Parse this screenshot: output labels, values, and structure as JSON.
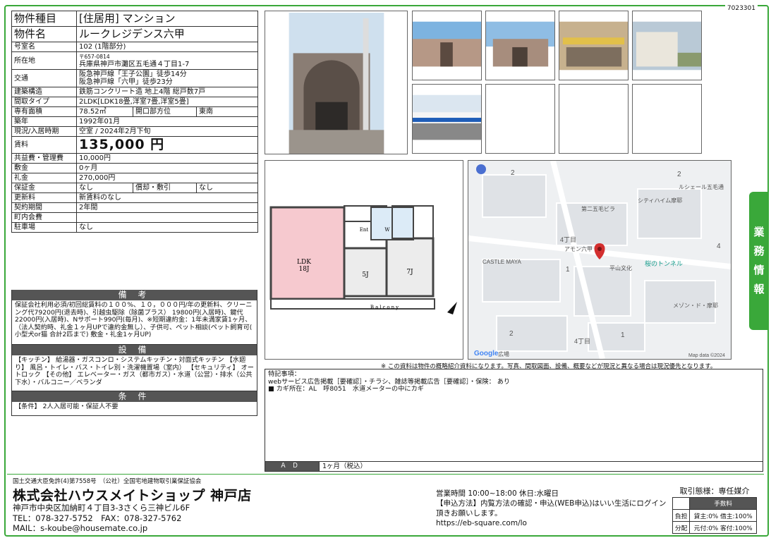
{
  "doc_id": "7023301",
  "spec": [
    {
      "k": "物件種目",
      "v": "[住居用] マンション",
      "big": true
    },
    {
      "k": "物件名",
      "v": "ルークレジデンス六甲",
      "big": true
    },
    {
      "k": "号室名",
      "v": "102 (1階部分)"
    },
    {
      "k": "所在地",
      "v": "〒657-0814",
      "v2": "兵庫県神戸市灘区五毛通４丁目1-7"
    },
    {
      "k": "交通",
      "v": "阪急神戸線「王子公園」徒歩14分",
      "v2": "阪急神戸線「六甲」徒歩23分"
    },
    {
      "k": "建築構造",
      "v": "鉄筋コンクリート造 地上4階 総戸数7戸"
    },
    {
      "k": "間取タイプ",
      "v": "2LDK[LDK18畳,洋室7畳,洋室5畳]"
    },
    {
      "k": "専有面積",
      "v": "78.52㎡",
      "k2": "開口部方位",
      "v3": "東南"
    },
    {
      "k": "築年",
      "v": "1992年01月"
    },
    {
      "k": "現況/入居時期",
      "v": "空室 / 2024年2月下旬"
    },
    {
      "k": "賃料",
      "v": "135,000 円",
      "rent": true
    },
    {
      "k": "共益費・管理費",
      "v": "10,000円"
    },
    {
      "k": "敷金",
      "v": "0ヶ月"
    },
    {
      "k": "礼金",
      "v": "270,000円"
    },
    {
      "k": "保証金",
      "v": "なし",
      "k2": "償却・敷引",
      "v3": "なし"
    },
    {
      "k": "更新料",
      "v": "新賃料のなし"
    },
    {
      "k": "契約期間",
      "v": "2年間"
    },
    {
      "k": "町内会費",
      "v": ""
    },
    {
      "k": "駐車場",
      "v": "なし"
    }
  ],
  "biko": {
    "title": "備 考",
    "text": "保証会社利用必須/初回総賃料の１００%、１０，０００円/年の更新料、クリーニング代79200円(退去時)、引越虫駆除（除菌プラス） 19800円(入居時)、鍵代22000円(入居時)、Nサポート990円(毎月)、※短期違約金：1年未満家賃1ヶ月、（法人契約時、礼金１ヶ月UPで違約金無し）、子供可、ペット相談(ペット飼育可( 小型犬or猫 合計2匹まで) 敷金・礼金1ヶ月UP)"
  },
  "setsubi": {
    "title": "設 備",
    "text": "【キッチン】 給湯器・ガスコンロ・システムキッチン・対面式キッチン 【水廻り】 風呂・トイレ・バス・トイレ別・洗濯機置場（室内） 【セキュリティ】 オートロック 【その他】 エレベーター・ガス（都市ガス）・水道（公営）・排水（公共下水）・バルコニー／ベランダ"
  },
  "joken": {
    "title": "条 件",
    "text": "【条件】 2人入居可能・保証人不要"
  },
  "floorplan": {
    "ldk": "LDK",
    "ldk_size": "18J",
    "r1": "5J",
    "r2": "7J",
    "ent": "Ent",
    "wc": "W",
    "balcony": "Balcony"
  },
  "map": {
    "labels": [
      "ルシェール五毛通",
      "第二五毛ビラ",
      "シティハイム摩耶",
      "4丁目",
      "アモン六甲",
      "CASTLE MAYA",
      "平山文化",
      "桜のトンネル",
      "メゾン・ド・摩耶",
      "4丁目",
      "広場"
    ],
    "numbers": [
      "2",
      "2",
      "4",
      "1",
      "2",
      "1"
    ],
    "logo": "Google",
    "credit": "Map data ©2024"
  },
  "note": "※ この資料は物件の概略紹介資料になります。写真、間取図面、設備、概要などが現況と異なる場合は現況優先となります。",
  "tokki": {
    "title": "特記事項：",
    "l1": "webサービス広告掲載［要確認］・チラシ、雑誌等掲載広告［要確認］・保険： あり",
    "l2": "■ カギ所在：AL　呼8051　水道メーターの中にカギ"
  },
  "ad": {
    "label": "ＡＤ",
    "value": "1ヶ月（税込）"
  },
  "side_tab": [
    "業",
    "務",
    "情",
    "報"
  ],
  "footer": {
    "license": "国土交通大臣免許(4)第7558号　（公社）全国宅地建物取引業保証協会",
    "company": "株式会社ハウスメイトショップ 神戸店",
    "address": "神戸市中央区加納町４丁目3-3さくら三神ビル6F",
    "tel": "TEL：078-327-5752　FAX：078-327-5762",
    "mail": "MAIL：s-koube@housemate.co.jp",
    "hours": "営業時間 10:00~18:00 休日:水曜日",
    "apply": "【申込方法】内覧方法の確認・申込(WEB申込)はいい生活にログイン頂きお願いします。",
    "url": "https://eb-square.com/lo"
  },
  "trade": {
    "title": "取引態様：専任媒介",
    "fee": "手数料",
    "r1k": "負担",
    "r1v": "貸主:0% 借主:100%",
    "r2k": "分配",
    "r2v": "元付:0% 客付:100%"
  },
  "colors": {
    "green": "#3aa83a",
    "header": "#555555",
    "ldk": "#f6c9cf",
    "map_pin": "#d32f2f"
  }
}
